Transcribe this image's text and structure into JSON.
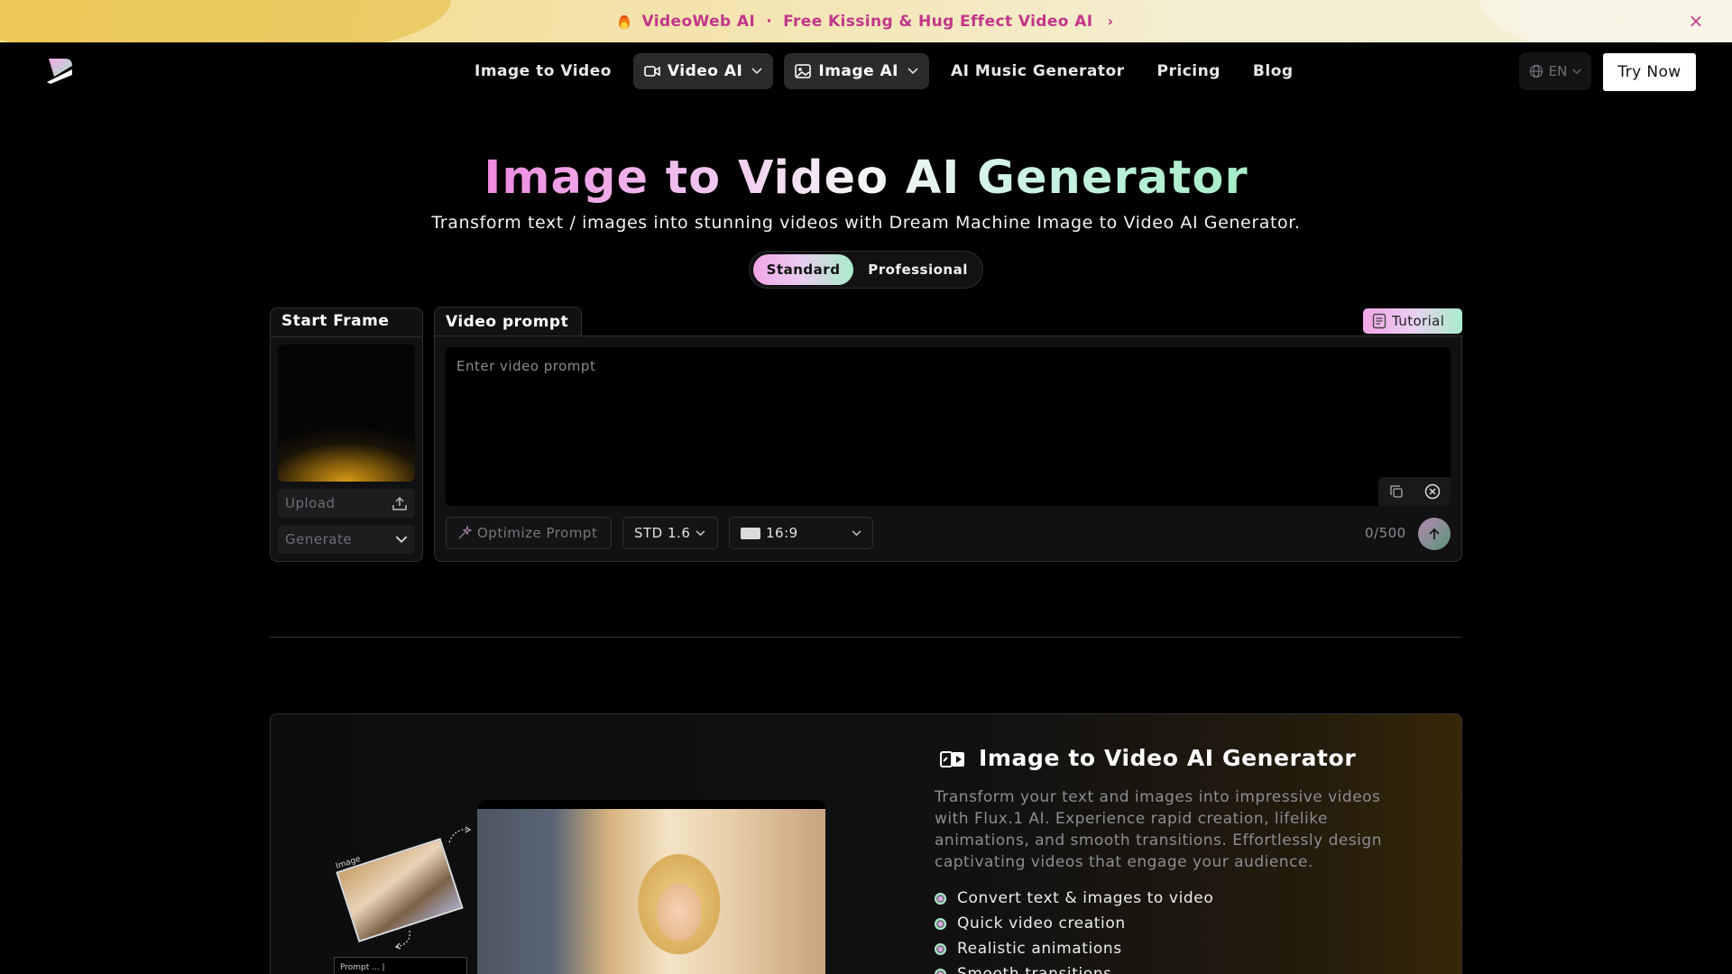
{
  "promo": {
    "brand": "VideoWeb AI",
    "separator": "·",
    "text": "Free Kissing & Hug Effect Video AI",
    "arrow": "›",
    "close_glyph": "×",
    "colors": {
      "accent": "#c2368a",
      "bg_start": "#f6dc7c",
      "bg_end": "#f6f0da"
    }
  },
  "nav": {
    "links": [
      {
        "label": "Image to Video",
        "type": "link"
      },
      {
        "label": "Video AI",
        "type": "dropdown",
        "icon": "video-camera-icon"
      },
      {
        "label": "Image AI",
        "type": "dropdown",
        "icon": "image-icon"
      },
      {
        "label": "AI Music Generator",
        "type": "link"
      },
      {
        "label": "Pricing",
        "type": "link"
      },
      {
        "label": "Blog",
        "type": "link"
      }
    ],
    "language": "EN",
    "cta": "Try Now"
  },
  "hero": {
    "title": "Image to Video AI Generator",
    "subtitle": "Transform text / images into stunning videos with Dream Machine Image to Video AI Generator.",
    "modes": [
      "Standard",
      "Professional"
    ],
    "active_mode": "Standard"
  },
  "start_frame": {
    "title": "Start Frame",
    "upload_label": "Upload",
    "generate_label": "Generate"
  },
  "prompt": {
    "tab_label": "Video prompt",
    "tutorial_label": "Tutorial",
    "placeholder": "Enter video prompt",
    "optimize_label": "Optimize Prompt",
    "model": "STD 1.6",
    "aspect_ratio": "16:9",
    "counter": "0/500"
  },
  "feature": {
    "title": "Image to Video AI Generator",
    "description": "Transform your text and images into impressive videos with Flux.1 AI. Experience rapid creation, lifelike animations, and smooth transitions. Effortlessly design captivating videos that engage your audience.",
    "bullets": [
      "Convert text & images to video",
      "Quick video creation",
      "Realistic animations",
      "Smooth transitions"
    ],
    "illustration": {
      "image_label": "Image",
      "prompt_label": "Prompt ... |"
    }
  },
  "colors": {
    "background": "#000000",
    "panel": "#111113",
    "border": "#2f2f33",
    "gradient_pink": "#f2a5e6",
    "gradient_green": "#a9eccb"
  }
}
